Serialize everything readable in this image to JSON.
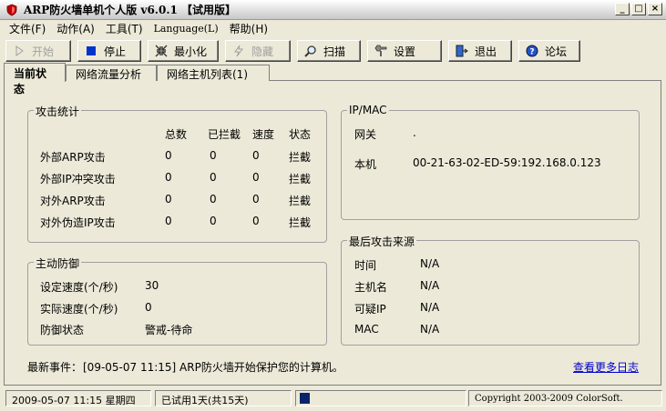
{
  "window": {
    "title": "ARP防火墙单机个人版 v6.0.1 【试用版】",
    "controls": [
      "_",
      "□",
      "×"
    ]
  },
  "menu": [
    {
      "label": "文件(F)"
    },
    {
      "label": "动作(A)"
    },
    {
      "label": "工具(T)"
    },
    {
      "label": "Language(L)"
    },
    {
      "label": "帮助(H)"
    }
  ],
  "toolbar": {
    "start": "开始",
    "stop": "停止",
    "minimize": "最小化",
    "hide": "隐藏",
    "scan": "扫描",
    "settings": "设置",
    "exit": "退出",
    "forum": "论坛"
  },
  "tabs": [
    {
      "label": "当前状态"
    },
    {
      "label": "网络流量分析"
    },
    {
      "label": "网络主机列表(1)"
    }
  ],
  "attack_stats": {
    "title": "攻击统计",
    "headers": [
      "总数",
      "已拦截",
      "速度",
      "状态"
    ],
    "rows": [
      {
        "name": "外部ARP攻击",
        "total": "0",
        "blocked": "0",
        "speed": "0",
        "status": "拦截"
      },
      {
        "name": "外部IP冲突攻击",
        "total": "0",
        "blocked": "0",
        "speed": "0",
        "status": "拦截"
      },
      {
        "name": "对外ARP攻击",
        "total": "0",
        "blocked": "0",
        "speed": "0",
        "status": "拦截"
      },
      {
        "name": "对外伪造IP攻击",
        "total": "0",
        "blocked": "0",
        "speed": "0",
        "status": "拦截"
      }
    ]
  },
  "ipmac": {
    "title": "IP/MAC",
    "gateway_label": "网关",
    "gateway_value": ".",
    "local_label": "本机",
    "local_value": "00-21-63-02-ED-59:192.168.0.123"
  },
  "active_defense": {
    "title": "主动防御",
    "set_speed_label": "设定速度(个/秒)",
    "set_speed_value": "30",
    "actual_speed_label": "实际速度(个/秒)",
    "actual_speed_value": "0",
    "state_label": "防御状态",
    "state_value": "警戒-待命"
  },
  "last_attack": {
    "title": "最后攻击来源",
    "time_label": "时间",
    "time_value": "N/A",
    "host_label": "主机名",
    "host_value": "N/A",
    "ip_label": "可疑IP",
    "ip_value": "N/A",
    "mac_label": "MAC",
    "mac_value": "N/A"
  },
  "latest_event": {
    "label": "最新事件：",
    "text": "[09-05-07 11:15] ARP防火墙开始保护您的计算机。",
    "more_link": "查看更多日志"
  },
  "statusbar": {
    "datetime": "2009-05-07 11:15 星期四",
    "trial": "已试用1天(共15天)",
    "copyright": "Copyright 2003-2009 ColorSoft."
  },
  "colors": {
    "window_bg": "#ECE9D8",
    "link": "#0000CC",
    "progress": "#0A246A"
  }
}
